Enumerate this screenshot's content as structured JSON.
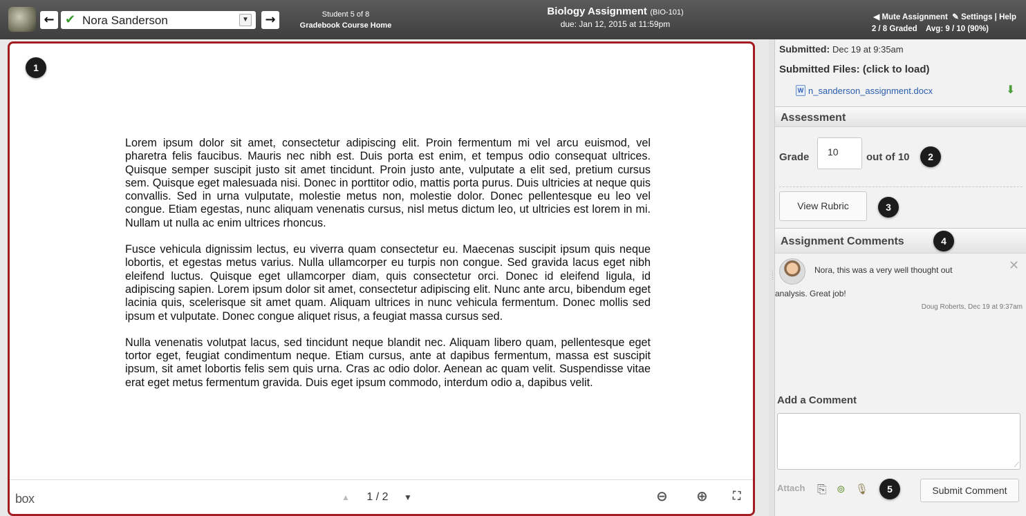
{
  "topbar": {
    "student_name": "Nora Sanderson",
    "student_position": "Student 5 of 8",
    "gradebook_link": "Gradebook",
    "course_home_link": "Course Home",
    "assignment_title": "Biology Assignment",
    "assignment_code": "(BIO-101)",
    "due_date": "due: Jan 12, 2015 at 11:59pm",
    "mute_label": "Mute Assignment",
    "settings_label": "Settings",
    "help_label": "Help",
    "graded_count": "2 / 8 Graded",
    "average": "Avg: 9 / 10 (90%)"
  },
  "document": {
    "paragraphs": [
      "Lorem ipsum dolor sit amet, consectetur adipiscing elit. Proin fermentum mi vel arcu euismod, vel pharetra felis faucibus. Mauris nec nibh est. Duis porta est enim, et tempus odio consequat ultrices. Quisque semper suscipit justo sit amet tincidunt. Proin justo ante, vulputate a elit sed, pretium cursus sem. Quisque eget malesuada nisi. Donec in porttitor odio, mattis porta purus. Duis ultricies at neque quis convallis. Sed in urna vulputate, molestie metus non, molestie dolor. Donec pellentesque eu leo vel congue. Etiam egestas, nunc aliquam venenatis cursus, nisl metus dictum leo, ut ultricies est lorem in mi. Nullam ut nulla ac enim ultrices rhoncus.",
      "Fusce vehicula dignissim lectus, eu viverra quam consectetur eu. Maecenas suscipit ipsum quis neque lobortis, et egestas metus varius. Nulla ullamcorper eu turpis non congue. Sed gravida lacus eget nibh eleifend luctus. Quisque eget ullamcorper diam, quis consectetur orci. Donec id eleifend ligula, id adipiscing sapien. Lorem ipsum dolor sit amet, consectetur adipiscing elit. Nunc ante arcu, bibendum eget lacinia quis, scelerisque sit amet quam. Aliquam ultrices in nunc vehicula fermentum. Donec mollis sed ipsum et vulputate. Donec congue aliquet risus, a feugiat massa cursus sed.",
      "Nulla venenatis volutpat lacus, sed tincidunt neque blandit nec. Aliquam libero quam, pellentesque eget tortor eget, feugiat condimentum neque. Etiam cursus, ante at dapibus fermentum, massa est suscipit ipsum, sit amet lobortis felis sem quis urna. Cras ac odio dolor. Aenean ac quam velit. Suspendisse vitae erat eget metus fermentum gravida. Duis eget ipsum commodo, interdum odio a, dapibus velit."
    ],
    "viewer_brand": "box",
    "page_indicator": "1 / 2"
  },
  "badges": [
    "1",
    "2",
    "3",
    "4",
    "5"
  ],
  "sidebar": {
    "submitted_label": "Submitted:",
    "submitted_date": "Dec 19 at 9:35am",
    "files_label": "Submitted Files: (click to load)",
    "file_name": "n_sanderson_assignment.docx",
    "assessment_header": "Assessment",
    "grade_label": "Grade",
    "grade_value": "10",
    "out_of": "out of 10",
    "view_rubric": "View Rubric",
    "comments_header": "Assignment Comments",
    "comment_text_1": "Nora, this was a very well thought out",
    "comment_text_2": "analysis. Great job!",
    "comment_meta": "Doug Roberts, Dec 19 at 9:37am",
    "add_comment_label": "Add a Comment",
    "attach_label": "Attach",
    "submit_comment": "Submit Comment"
  },
  "colors": {
    "frame_border": "#a31c21",
    "topbar": "#4a4a4a",
    "checkmark": "#3a9b2d",
    "link": "#2a5db0"
  }
}
